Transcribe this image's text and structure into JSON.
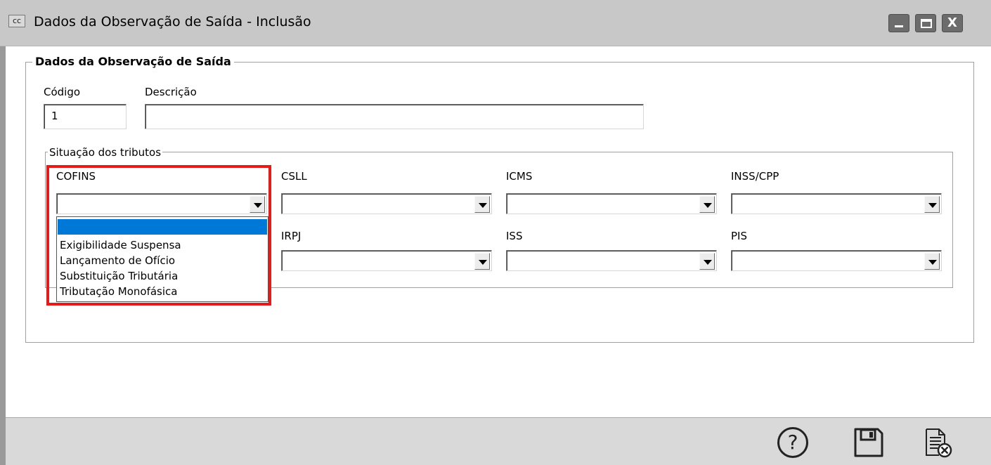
{
  "window": {
    "icon_label": "cc",
    "title": "Dados da Observação de Saída - Inclusão",
    "buttons": {
      "minimize": "minimize",
      "maximize": "maximize",
      "close": "X"
    }
  },
  "form": {
    "group_title": "Dados da Observação de Saída",
    "codigo": {
      "label": "Código",
      "value": "1"
    },
    "descricao": {
      "label": "Descrição",
      "value": ""
    }
  },
  "tributos": {
    "group_title": "Situação dos tributos",
    "fields": [
      {
        "label": "COFINS",
        "value": ""
      },
      {
        "label": "CSLL",
        "value": ""
      },
      {
        "label": "ICMS",
        "value": ""
      },
      {
        "label": "INSS/CPP",
        "value": ""
      },
      {
        "label": "IRPJ",
        "value": ""
      },
      {
        "label": "ISS",
        "value": ""
      },
      {
        "label": "PIS",
        "value": ""
      }
    ],
    "cofins_dropdown_options": [
      "",
      "Exigibilidade Suspensa",
      "Lançamento de Ofício",
      "Substituição Tributária",
      "Tributação Monofásica"
    ]
  },
  "toolbar": {
    "help_glyph": "?",
    "icons": [
      "help-icon",
      "save-icon",
      "cancel-document-icon"
    ]
  },
  "colors": {
    "highlight": "#e51b1b",
    "selection": "#0078d7",
    "titlebar": "#c8c8c8",
    "statusbar": "#d9d9d9"
  }
}
